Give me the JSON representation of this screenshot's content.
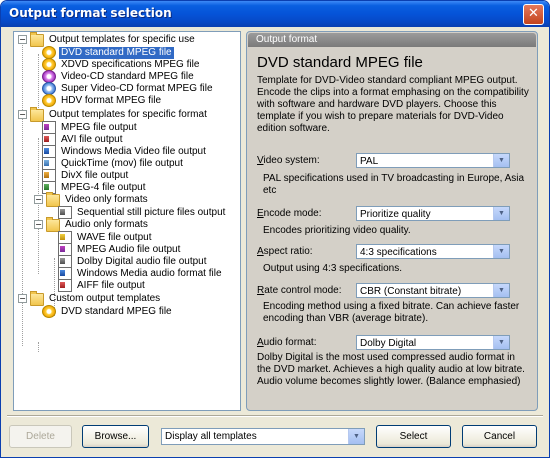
{
  "window": {
    "title": "Output format selection",
    "close": "✕"
  },
  "tree": {
    "groups": [
      {
        "label": "Output templates for specific use",
        "items": [
          "DVD standard MPEG file",
          "XDVD specifications MPEG file",
          "Video-CD standard MPEG file",
          "Super Video-CD format MPEG file",
          "HDV format MPEG file"
        ]
      },
      {
        "label": "Output templates for specific format",
        "items": [
          "MPEG file output",
          "AVI file output",
          "Windows Media Video file output",
          "QuickTime (mov) file output",
          "DivX file output",
          "MPEG-4 file output"
        ],
        "subgroups": [
          {
            "label": "Video only formats",
            "items": [
              "Sequential still picture files output"
            ]
          },
          {
            "label": "Audio only formats",
            "items": [
              "WAVE file output",
              "MPEG Audio file output",
              "Dolby Digital audio file output",
              "Windows Media audio format file",
              "AIFF file output"
            ]
          }
        ]
      },
      {
        "label": "Custom output templates",
        "items": [
          "DVD standard MPEG file"
        ]
      }
    ],
    "selected": "DVD standard MPEG file"
  },
  "panel": {
    "header": "Output format",
    "title": "DVD standard MPEG file",
    "description": "Template for DVD-Video standard compliant MPEG output. Encode the clips into a format emphasing on the compatibility with software and hardware DVD players. Choose this template if you wish to prepare materials for DVD-Video edition software.",
    "fields": [
      {
        "label_key": "V",
        "label_rest": "ideo system:",
        "value": "PAL",
        "note": "PAL specifications used in TV broadcasting in Europe, Asia etc"
      },
      {
        "label_key": "E",
        "label_rest": "ncode mode:",
        "value": "Prioritize quality",
        "note": "Encodes prioritizing video quality."
      },
      {
        "label_key": "A",
        "label_rest": "spect ratio:",
        "value": "4:3 specifications",
        "note": "Output using 4:3 specifications."
      },
      {
        "label_key": "R",
        "label_rest": "ate control mode:",
        "value": "CBR (Constant bitrate)",
        "note": "Encoding method using a fixed bitrate. Can achieve faster encoding than VBR (average bitrate)."
      },
      {
        "label_key": "A",
        "label_rest": "udio format:",
        "value": "Dolby Digital",
        "note": "Dolby Digital is the most used compressed audio format in the DVD market. Achieves a high quality audio at low bitrate. Audio volume becomes slightly lower. (Balance emphasied)"
      }
    ]
  },
  "bottom": {
    "delete_label": "Delete",
    "browse_label": "Browse...",
    "filter_value": "Display all templates",
    "select_label": "Select",
    "cancel_label": "Cancel"
  },
  "icons": {
    "expanded": "−",
    "dropdown": "▼"
  },
  "colors": {
    "title_bar": "#0553d8",
    "selection": "#316ac5",
    "window_bg": "#ece9d8"
  }
}
